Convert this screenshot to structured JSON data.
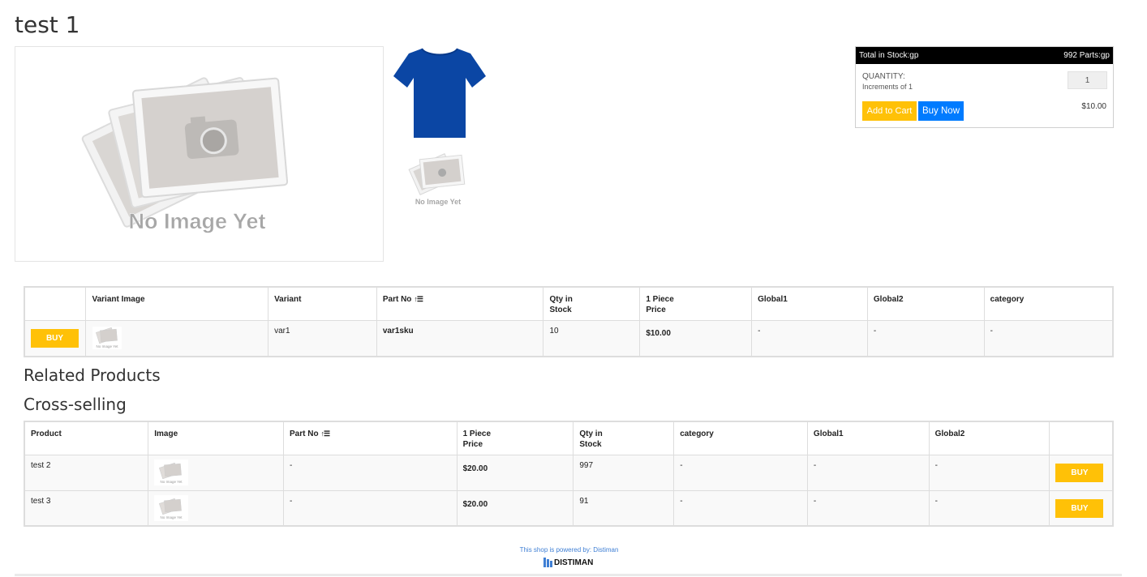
{
  "product": {
    "title": "test 1"
  },
  "gallery": {
    "main_caption": "No Image Yet",
    "thumb_caption": "No Image Yet",
    "shirt_color": "#0b46a4"
  },
  "buy_box": {
    "stock_label": "Total in Stock:gp",
    "stock_value": "992 Parts:gp",
    "quantity_label": "QUANTITY:",
    "increments": "Increments of 1",
    "quantity_value": "1",
    "add_to_cart": "Add to Cart",
    "buy_now": "Buy Now",
    "price": "$10.00"
  },
  "variants_table": {
    "headers": [
      "",
      "Variant Image",
      "Variant",
      "Part No",
      "Qty in Stock",
      "1 Piece Price",
      "Global1",
      "Global2",
      "category"
    ],
    "rows": [
      {
        "buy": "BUY",
        "image_caption": "No Image Yet",
        "variant": "var1",
        "part_no": "var1sku",
        "qty": "10",
        "price": "$10.00",
        "global1": "-",
        "global2": "-",
        "category": "-"
      }
    ]
  },
  "sections": {
    "related": "Related Products",
    "cross": "Cross-selling"
  },
  "cross_table": {
    "headers": [
      "Product",
      "Image",
      "Part No",
      "1 Piece Price",
      "Qty in Stock",
      "category",
      "Global1",
      "Global2",
      ""
    ],
    "rows": [
      {
        "product": "test 2",
        "image_caption": "No Image Yet",
        "part_no": "-",
        "price": "$20.00",
        "qty": "997",
        "category": "-",
        "global1": "-",
        "global2": "-",
        "buy": "BUY"
      },
      {
        "product": "test 3",
        "image_caption": "No Image Yet",
        "part_no": "-",
        "price": "$20.00",
        "qty": "91",
        "category": "-",
        "global1": "-",
        "global2": "-",
        "buy": "BUY"
      }
    ]
  },
  "footer": {
    "powered_by": "This shop is powered by: Distiman",
    "logo_text": "DISTIMAN"
  },
  "colors": {
    "yellow": "#ffc107",
    "blue": "#007bff",
    "link": "#3f7fd4"
  }
}
